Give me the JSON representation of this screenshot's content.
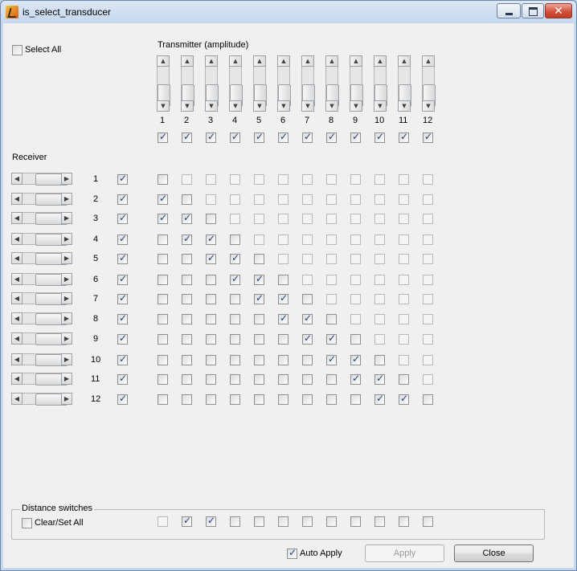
{
  "window": {
    "title": "is_select_transducer"
  },
  "select_all": {
    "label": "Select All",
    "checked": false
  },
  "transmitter": {
    "label": "Transmitter (amplitude)",
    "columns": [
      "1",
      "2",
      "3",
      "4",
      "5",
      "6",
      "7",
      "8",
      "9",
      "10",
      "11",
      "12"
    ],
    "enabled": [
      true,
      true,
      true,
      true,
      true,
      true,
      true,
      true,
      true,
      true,
      true,
      true
    ]
  },
  "receiver": {
    "label": "Receiver",
    "rows": [
      {
        "label": "1",
        "enabled": true,
        "matrix": [
          0,
          0,
          0,
          0,
          0,
          0,
          0,
          0,
          0,
          0,
          0,
          0
        ],
        "disabled_from": 1
      },
      {
        "label": "2",
        "enabled": true,
        "matrix": [
          1,
          0,
          0,
          0,
          0,
          0,
          0,
          0,
          0,
          0,
          0,
          0
        ],
        "disabled_from": 2
      },
      {
        "label": "3",
        "enabled": true,
        "matrix": [
          1,
          1,
          0,
          0,
          0,
          0,
          0,
          0,
          0,
          0,
          0,
          0
        ],
        "disabled_from": 3
      },
      {
        "label": "4",
        "enabled": true,
        "matrix": [
          0,
          1,
          1,
          0,
          0,
          0,
          0,
          0,
          0,
          0,
          0,
          0
        ],
        "disabled_from": 4
      },
      {
        "label": "5",
        "enabled": true,
        "matrix": [
          0,
          0,
          1,
          1,
          0,
          0,
          0,
          0,
          0,
          0,
          0,
          0
        ],
        "disabled_from": 5
      },
      {
        "label": "6",
        "enabled": true,
        "matrix": [
          0,
          0,
          0,
          1,
          1,
          0,
          0,
          0,
          0,
          0,
          0,
          0
        ],
        "disabled_from": 6
      },
      {
        "label": "7",
        "enabled": true,
        "matrix": [
          0,
          0,
          0,
          0,
          1,
          1,
          0,
          0,
          0,
          0,
          0,
          0
        ],
        "disabled_from": 7
      },
      {
        "label": "8",
        "enabled": true,
        "matrix": [
          0,
          0,
          0,
          0,
          0,
          1,
          1,
          0,
          0,
          0,
          0,
          0
        ],
        "disabled_from": 8
      },
      {
        "label": "9",
        "enabled": true,
        "matrix": [
          0,
          0,
          0,
          0,
          0,
          0,
          1,
          1,
          0,
          0,
          0,
          0
        ],
        "disabled_from": 9
      },
      {
        "label": "10",
        "enabled": true,
        "matrix": [
          0,
          0,
          0,
          0,
          0,
          0,
          0,
          1,
          1,
          0,
          0,
          0
        ],
        "disabled_from": 10
      },
      {
        "label": "11",
        "enabled": true,
        "matrix": [
          0,
          0,
          0,
          0,
          0,
          0,
          0,
          0,
          1,
          1,
          0,
          0
        ],
        "disabled_from": 11
      },
      {
        "label": "12",
        "enabled": true,
        "matrix": [
          0,
          0,
          0,
          0,
          0,
          0,
          0,
          0,
          0,
          1,
          1,
          0
        ],
        "disabled_from": 12
      }
    ]
  },
  "distance_switches": {
    "label": "Distance switches",
    "clear_set_label": "Clear/Set All",
    "clear_set_checked": false,
    "values": [
      0,
      1,
      1,
      0,
      0,
      0,
      0,
      0,
      0,
      0,
      0,
      0
    ],
    "first_disabled": true
  },
  "footer": {
    "auto_apply_label": "Auto Apply",
    "auto_apply_checked": true,
    "apply_label": "Apply",
    "close_label": "Close"
  }
}
